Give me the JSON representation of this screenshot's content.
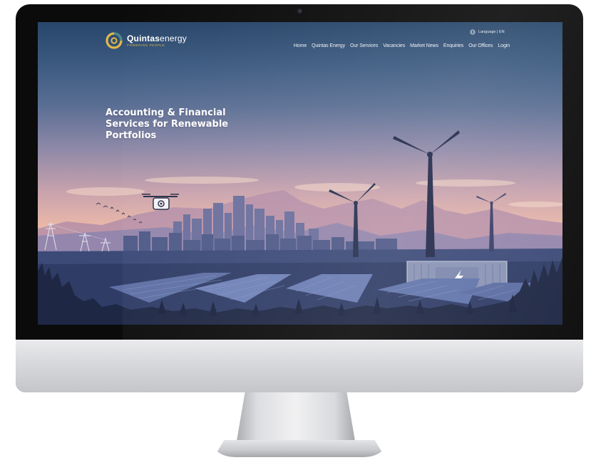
{
  "site": {
    "brand_bold": "Quintas",
    "brand_light": "energy",
    "tagline": "powering people",
    "language_label": "Language | EN",
    "nav": [
      {
        "label": "Home"
      },
      {
        "label": "Quintas Energy"
      },
      {
        "label": "Our Services"
      },
      {
        "label": "Vacancies"
      },
      {
        "label": "Market News"
      },
      {
        "label": "Enquiries"
      },
      {
        "label": "Our Offices"
      },
      {
        "label": "Login"
      }
    ],
    "hero_title": "Accounting & Financial Services for Renewable Portfolios"
  },
  "colors": {
    "logo_gold": "#e1b74a",
    "logo_teal": "#4a8a8c",
    "nav_text": "#eef2f8",
    "sky_top": "#28466a",
    "sky_glow": "#f2c6b0",
    "foreground_dark": "#1f2d4a"
  },
  "icons": {
    "logo": "quintas-logo-icon",
    "globe": "globe-icon",
    "drone": "drone-icon",
    "lightning": "lightning-bolt-icon",
    "birds": "birds-icon"
  }
}
